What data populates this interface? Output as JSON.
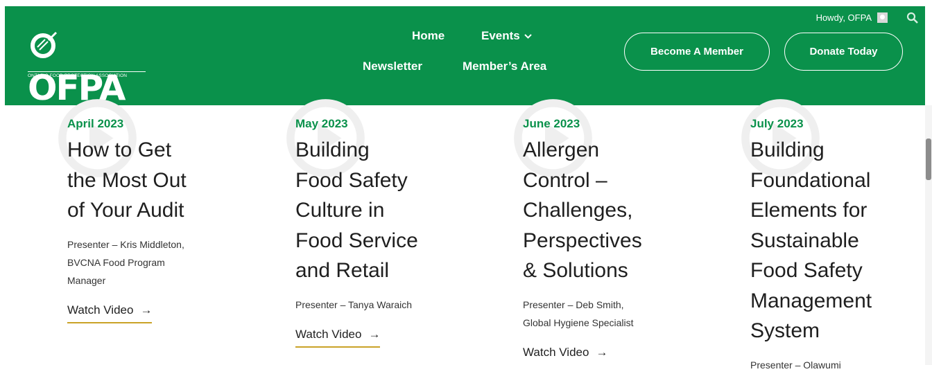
{
  "header": {
    "logo": {
      "word": "OFPA",
      "tagline": "ONTARIO FOOD PROTECTION ASSOCIATION"
    },
    "nav": [
      {
        "label": "Home"
      },
      {
        "label": "Events",
        "icon": "chevron-down-icon"
      },
      {
        "label": "Newsletter"
      },
      {
        "label": "Member’s Area"
      }
    ],
    "cta": {
      "member": "Become A Member",
      "donate": "Donate Today"
    },
    "user": {
      "greeting": "Howdy, OFPA"
    }
  },
  "colors": {
    "brand_green": "#0a914b",
    "underline_gold": "#c9a227",
    "text_dark": "#1f1f1f"
  },
  "events": [
    {
      "date": "April 2023",
      "title": [
        "How to Get",
        "the Most Out",
        "of Your Audit"
      ],
      "presenter": [
        "Presenter – Kris Middleton,",
        "BVCNA Food Program",
        "Manager"
      ],
      "link": "Watch Video"
    },
    {
      "date": "May 2023",
      "title": [
        "Building",
        "Food Safety",
        "Culture in",
        "Food Service",
        "and Retail"
      ],
      "presenter": [
        "Presenter – Tanya Waraich"
      ],
      "link": "Watch Video"
    },
    {
      "date": "June 2023",
      "title": [
        "Allergen",
        "Control –",
        "Challenges,",
        "Perspectives",
        "& Solutions"
      ],
      "presenter": [
        "Presenter – Deb Smith,",
        "Global Hygiene Specialist"
      ],
      "link": "Watch Video"
    },
    {
      "date": "July 2023",
      "title": [
        "Building",
        "Foundational",
        "Elements for",
        "Sustainable",
        "Food Safety",
        "Management",
        "System"
      ],
      "presenter": [
        "Presenter – Olawumi"
      ],
      "link": ""
    }
  ]
}
